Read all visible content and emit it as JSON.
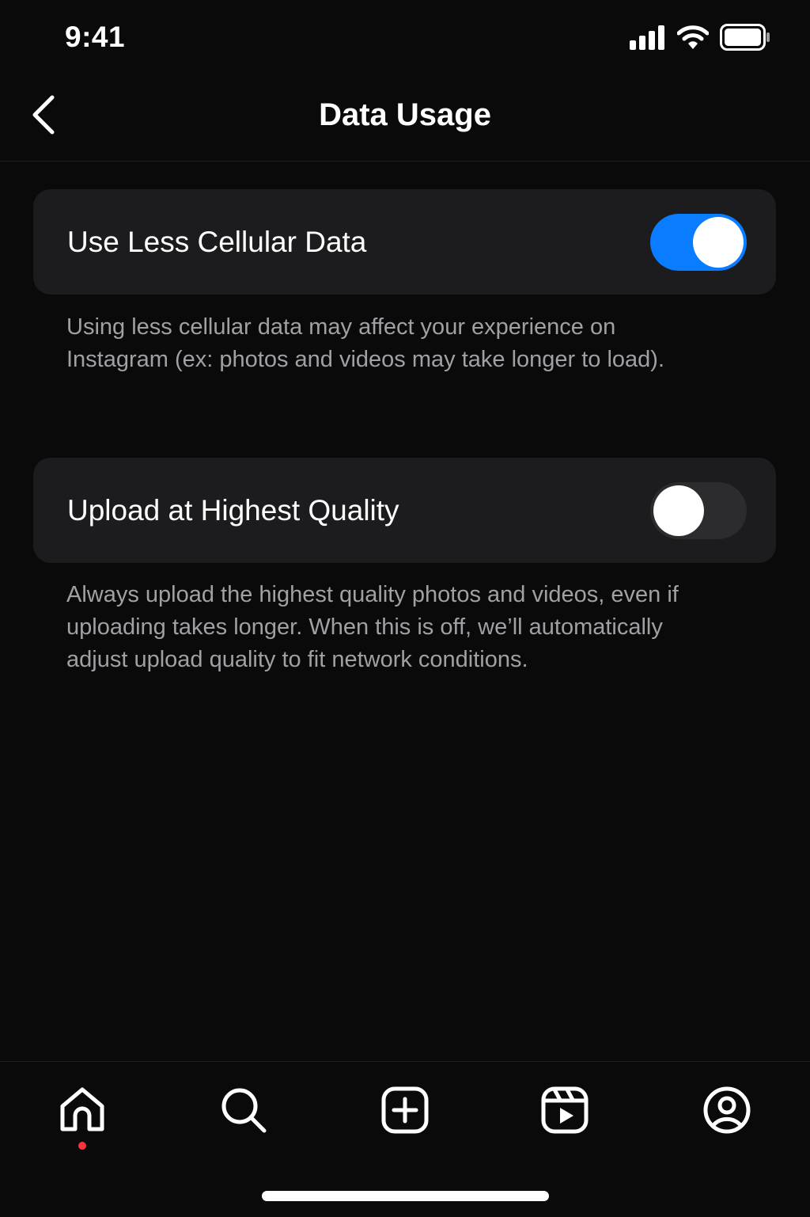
{
  "status_bar": {
    "time": "9:41"
  },
  "header": {
    "title": "Data Usage"
  },
  "settings": [
    {
      "label": "Use Less Cellular Data",
      "enabled": true,
      "description": "Using less cellular data may affect your experience on Instagram (ex: photos and videos may take longer to load)."
    },
    {
      "label": "Upload at Highest Quality",
      "enabled": false,
      "description": "Always upload the highest quality photos and videos, even if uploading takes longer. When this is off, we’ll automatically adjust upload quality to fit network conditions."
    }
  ],
  "bottom_nav": {
    "items": [
      "home-icon",
      "search-icon",
      "create-icon",
      "reels-icon",
      "profile-icon"
    ],
    "active": "home-icon",
    "notification_dot_color": "#ff3040"
  },
  "colors": {
    "toggle_on": "#0a7cff",
    "toggle_off": "#2c2c2e",
    "card_background": "#1c1c1e",
    "description_text": "#a0a0a5"
  }
}
